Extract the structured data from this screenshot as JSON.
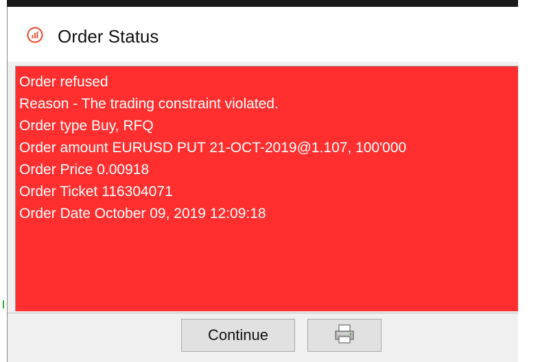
{
  "window": {
    "title": "Order Status",
    "close_glyph": "×"
  },
  "icons": {
    "app": "app-logo-icon",
    "close": "close-icon",
    "scroll_up": "scroll-up-arrow-icon",
    "scroll_down": "scroll-down-arrow-icon",
    "print": "printer-icon"
  },
  "message": {
    "lines": [
      "Order refused",
      "Reason - The trading constraint violated.",
      "Order type Buy, RFQ",
      "Order amount EURUSD PUT 21-OCT-2019@1.107, 100'000",
      "Order Price 0.00918",
      "Order Ticket 116304071",
      "Order Date October 09, 2019 12:09:18"
    ]
  },
  "buttons": {
    "continue_label": "Continue"
  },
  "colors": {
    "message_background": "#ff2f2f",
    "message_text": "#ffffff",
    "app_icon": "#e8553a"
  }
}
